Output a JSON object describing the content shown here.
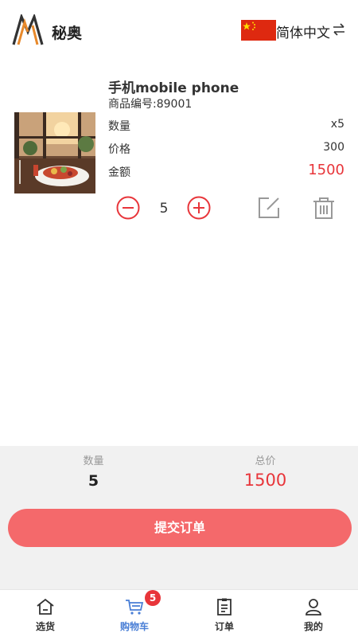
{
  "header": {
    "app_name": "秘奥",
    "language": "简体中文"
  },
  "cart_item": {
    "title": "手机mobile phone",
    "sku": "商品编号:89001",
    "quantity_label": "数量",
    "quantity_value": "x5",
    "price_label": "价格",
    "price_value": "300",
    "amount_label": "金额",
    "amount_value": "1500",
    "stepper_value": "5"
  },
  "summary": {
    "quantity_label": "数量",
    "quantity_value": "5",
    "total_label": "总价",
    "total_value": "1500",
    "submit_label": "提交订单"
  },
  "nav": {
    "items": [
      {
        "label": "选货",
        "icon": "home-icon"
      },
      {
        "label": "购物车",
        "icon": "cart-icon",
        "badge": "5",
        "active": true
      },
      {
        "label": "订单",
        "icon": "order-icon"
      },
      {
        "label": "我的",
        "icon": "user-icon"
      }
    ]
  },
  "colors": {
    "accent_red": "#e8353a",
    "submit_button": "#f4696b",
    "active_nav": "#4a7fd6",
    "summary_bg": "#f1f1f1"
  }
}
